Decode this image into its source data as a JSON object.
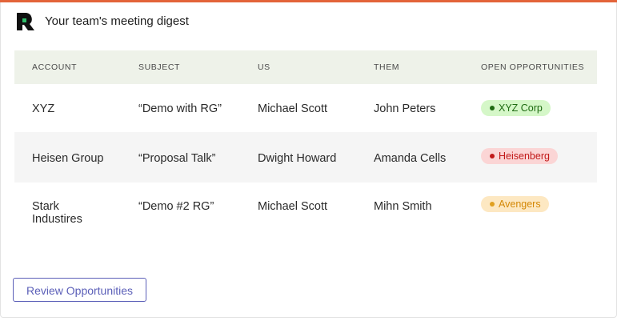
{
  "header": {
    "title": "Your team's meeting digest",
    "logo_icon": "rg-logo-icon"
  },
  "table": {
    "columns": [
      "ACCOUNT",
      "SUBJECT",
      "US",
      "THEM",
      "OPEN OPPORTUNITIES"
    ],
    "rows": [
      {
        "account": "XYZ",
        "subject": "“Demo with RG”",
        "us": "Michael Scott",
        "them": "John Peters",
        "opportunity": "XYZ Corp",
        "opportunity_color": "#1f6b12"
      },
      {
        "account": "Heisen Group",
        "subject": "“Proposal Talk”",
        "us": "Dwight Howard",
        "them": "Amanda Cells",
        "opportunity": "Heisenberg",
        "opportunity_color": "#c21919"
      },
      {
        "account": "Stark Industires",
        "account_line1": "Stark",
        "account_line2": "Industires",
        "subject": "“Demo #2 RG”",
        "us": "Michael Scott",
        "them": "Mihn Smith",
        "opportunity": "Avengers",
        "opportunity_color": "#d48806"
      }
    ]
  },
  "footer": {
    "button_label": "Review Opportunities"
  },
  "colors": {
    "accent_bar": "#e3643a",
    "button": "#5b5fb8",
    "header_row": "#eef2e9"
  }
}
